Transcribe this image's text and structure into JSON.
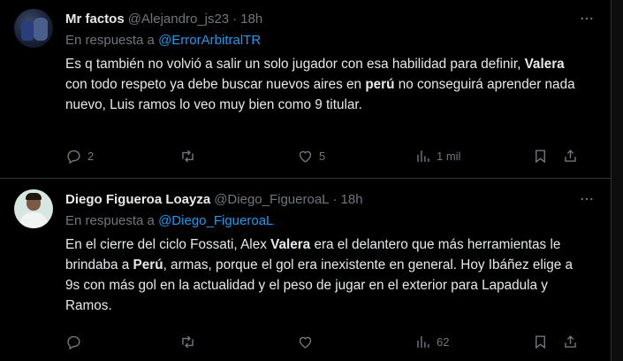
{
  "tweets": [
    {
      "display_name": "Mr factos",
      "handle": "@Alejandro_js23",
      "separator": "·",
      "time": "18h",
      "reply_prefix": "En respuesta a ",
      "reply_to": "@ErrorArbitralTR",
      "text_parts": [
        "Es q también no volvió a salir un solo jugador con esa habilidad para definir, ",
        "Valera",
        " con todo respeto ya debe buscar nuevos aires en ",
        "perú",
        " no conseguirá aprender nada nuevo, Luis ramos lo veo muy bien como 9 titular."
      ],
      "replies": "2",
      "retweets": "",
      "likes": "5",
      "views": "1 mil"
    },
    {
      "display_name": "Diego Figueroa Loayza",
      "handle": "@Diego_FigueroaL",
      "separator": "·",
      "time": "18h",
      "reply_prefix": "En respuesta a ",
      "reply_to": "@Diego_FigueroaL",
      "text_parts": [
        "En el cierre del ciclo Fossati, Alex ",
        "Valera",
        " era el delantero que más herramientas le brindaba a ",
        "Perú",
        ", armas, porque el gol era inexistente en general. Hoy Ibáñez elige a 9s con más gol en la actualidad y el peso de jugar en el exterior para Lapadula y Ramos."
      ],
      "replies": "",
      "retweets": "",
      "likes": "",
      "views": "62"
    }
  ],
  "icons": {
    "more": "more-horizontal-icon",
    "reply": "comment-icon",
    "retweet": "retweet-icon",
    "like": "heart-icon",
    "views": "analytics-icon",
    "bookmark": "bookmark-icon",
    "share": "share-icon"
  },
  "colors": {
    "background": "#000000",
    "text": "#e7e9ea",
    "muted": "#71767b",
    "link": "#1d9bf0",
    "border": "#2f3336"
  }
}
